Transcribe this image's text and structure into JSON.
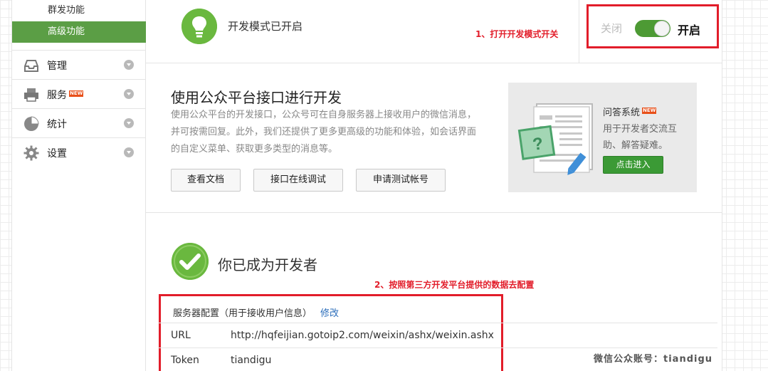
{
  "sidebar": {
    "sub_items": [
      "群发功能",
      "高级功能"
    ],
    "nav": [
      {
        "label": "管理",
        "icon": "inbox-icon",
        "badge": ""
      },
      {
        "label": "服务",
        "icon": "printer-icon",
        "badge": "NEW"
      },
      {
        "label": "统计",
        "icon": "pie-chart-icon",
        "badge": ""
      },
      {
        "label": "设置",
        "icon": "gear-icon",
        "badge": ""
      }
    ]
  },
  "header": {
    "mode_text": "开发模式已开启",
    "annotation": "1、打开开发模式开关",
    "toggle": {
      "off_label": "关闭",
      "on_label": "开启",
      "state": "on"
    }
  },
  "api": {
    "title": "使用公众平台接口进行开发",
    "description": "使用公众平台的开发接口，公众号可在自身服务器上接收用户的微信消息，并可按需回复。此外，我们还提供了更多更高级的功能和体验，如会话界面的自定义菜单、获取更多类型的消息等。",
    "buttons": [
      "查看文档",
      "接口在线调试",
      "申请测试帐号"
    ]
  },
  "promo": {
    "title": "问答系统",
    "badge": "NEW",
    "description": "用于开发者交流互助、解答疑难。",
    "button": "点击进入"
  },
  "developer": {
    "title": "你已成为开发者",
    "annotation": "2、按照第三方开发平台提供的数据去配置",
    "config_title": "服务器配置（用于接收用户信息）",
    "edit_link": "修改",
    "url_label": "URL",
    "url_value": "http://hqfeijian.gotoip2.com/weixin/ashx/weixin.ashx",
    "token_label": "Token",
    "token_value": "tiandigu"
  },
  "watermark": "微信公众账号：tiandigu",
  "colors": {
    "accent_green": "#5b9e45",
    "annotation_red": "#e21d2a",
    "link_blue": "#2b6dba",
    "new_badge": "#e8501a"
  }
}
